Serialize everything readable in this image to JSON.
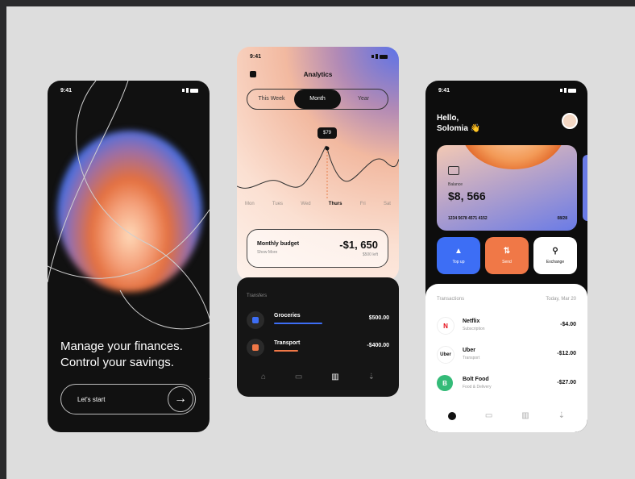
{
  "colors": {
    "background": "#dddddd",
    "accent_blue": "#3d6ef5",
    "accent_orange": "#f07847",
    "dark": "#111111"
  },
  "onboarding": {
    "time": "9:41",
    "headline_line1": "Manage your finances.",
    "headline_line2": "Control your savings.",
    "cta_label": "Let's start",
    "cta_icon": "arrow-right-icon"
  },
  "analytics": {
    "time": "9:41",
    "title": "Analytics",
    "segments": [
      "This Week",
      "Month",
      "Year"
    ],
    "active_segment": "Month",
    "tooltip": "$79",
    "x_labels": [
      "Mon",
      "Tues",
      "Wed",
      "Thurs",
      "Fri",
      "Sat"
    ],
    "active_label": "Thurs",
    "budget_title": "Monthly budget",
    "budget_subtitle": "Show More",
    "budget_amount": "-$1, 650",
    "budget_note": "$500 left"
  },
  "transactions_dark": {
    "header": "Transfers",
    "rows": [
      {
        "name": "Groceries",
        "value": "$500.00",
        "icon": "cart-icon",
        "color": "#3d6ef5"
      },
      {
        "name": "Transport",
        "value": "-$400.00",
        "icon": "car-icon",
        "color": "#f07847"
      }
    ],
    "tabs": [
      "home-icon",
      "card-icon",
      "chart-icon",
      "download-icon"
    ]
  },
  "wallet": {
    "time": "9:41",
    "greeting_line1": "Hello,",
    "greeting_line2": "Solomia 👋",
    "card": {
      "label": "Balance",
      "balance": "$8, 566",
      "number": "1234  5678  4571  4152",
      "expiry": "08/28"
    },
    "actions": [
      {
        "label": "Top up",
        "icon": "wallet-icon",
        "bg": "#3d6ef5",
        "fg": "#ffffff"
      },
      {
        "label": "Send",
        "icon": "swap-icon",
        "bg": "#f07847",
        "fg": "#ffffff"
      },
      {
        "label": "Exchange",
        "icon": "search-icon",
        "bg": "#ffffff",
        "fg": "#111111"
      }
    ],
    "transactions_title": "Transactions",
    "transactions_filter": "Today, Mar 20",
    "transactions": [
      {
        "name": "Netflix",
        "desc": "Subscription",
        "amount": "-$4.00",
        "logo": "N",
        "logo_bg": "#ffffff",
        "logo_fg": "#e50914"
      },
      {
        "name": "Uber",
        "desc": "Transport",
        "amount": "-$12.00",
        "logo": "Uber",
        "logo_bg": "#ffffff",
        "logo_fg": "#111111"
      },
      {
        "name": "Bolt Food",
        "desc": "Food & Delivery",
        "amount": "-$27.00",
        "logo": "B",
        "logo_bg": "#34bb78",
        "logo_fg": "#ffffff"
      }
    ],
    "tabs": [
      "home-icon",
      "card-icon",
      "chart-icon",
      "download-icon"
    ]
  }
}
